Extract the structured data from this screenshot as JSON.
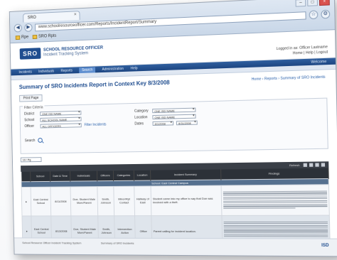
{
  "browser": {
    "tab_title": "SRO",
    "address": "www.schoolresourceofficer.com/Reports/IncidentReport/Summary",
    "bookmarks": [
      "Rpe",
      "SRO Rpts"
    ],
    "back": "◀",
    "forward": "▶"
  },
  "header": {
    "logo": "SRO",
    "brand_line1": "SCHOOL RESOURCE OFFICER",
    "brand_line2": "Incident Tracking System",
    "right_line1": "Logged in as: Officer Lastname",
    "right_line2": "Home | Help | Logout"
  },
  "menu": {
    "items": [
      "Incidents",
      "Individuals",
      "Reports",
      "Search",
      "Administration",
      "Help"
    ],
    "active_index": 3,
    "right_text": "Welcome"
  },
  "page": {
    "title": "Summary of SRO Incidents Report in Context Key 8/3/2008",
    "breadcrumb": "Home › Reports › Summary of SRO Incidents",
    "print_label": "Print Page"
  },
  "filters": {
    "legend": "Filter Criteria",
    "district_label": "District",
    "district_value": "ONE ISD NAME",
    "school_label": "School",
    "school_value": "ALL SCHOOL NAME",
    "officer_label": "Officer",
    "officer_value": "ALL OFFICERS",
    "category_label": "Category",
    "category_value": "ONE ISD NAME",
    "location_label": "Location",
    "location_value": "ONE ISD NAME",
    "dates_label": "Dates",
    "date_from": "8/1/2008",
    "date_to": "8/31/2008",
    "link_text": "Filter Incidents",
    "search_label": "Search"
  },
  "pager": {
    "value": "10 / Pg"
  },
  "table": {
    "toolbar_label": "Refresh",
    "columns": [
      "",
      "School",
      "Date & Time",
      "Individuals",
      "Officers",
      "Categories",
      "Location",
      "Incident Summary",
      "Findings"
    ],
    "group_label": "School: East Central Campus",
    "rows": [
      {
        "school": "East Central School",
        "date": "8/11/2008",
        "individuals": "Doe, Student Male Mom/Parent",
        "officers": "Smith, Johnson",
        "categories": "Minor/Rpt Contact",
        "location": "Hallway of East",
        "summary": "Student came into my office to say that Doe was involved with a theft."
      },
      {
        "school": "East Central School",
        "date": "8/13/2008",
        "individuals": "Doe, Student Male Mom/Parent",
        "officers": "Smith, Johnson",
        "categories": "Intervention Action",
        "location": "Office",
        "summary": "Parent calling for incident location."
      }
    ]
  },
  "footer": {
    "col1": "School Resource Officer Incident Tracking System",
    "col2": "Summary of SRO Incidents",
    "brand": "ISD"
  },
  "colors": {
    "brand": "#1f4d8f",
    "menu": "#2f5f9f",
    "table_header": "#2c3138"
  }
}
